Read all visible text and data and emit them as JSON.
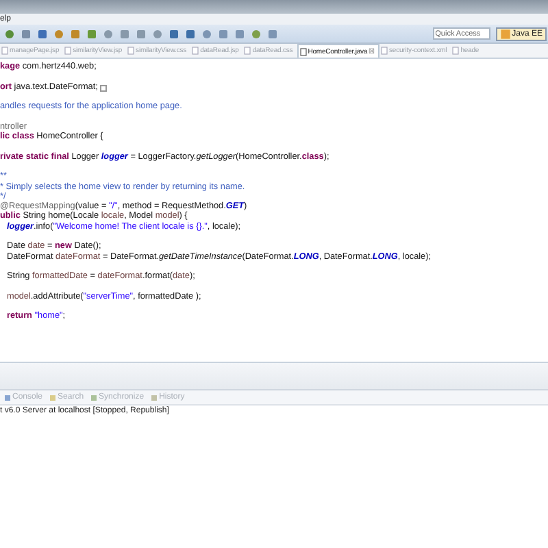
{
  "menu": {
    "items": [
      "elp"
    ]
  },
  "toolbar": {
    "quick_access": {
      "placeholder": "Quick Access"
    },
    "perspective": {
      "label": "Java EE",
      "selected": true
    }
  },
  "tabs": [
    {
      "label": "managePage.jsp",
      "selected": false
    },
    {
      "label": "similarityView.jsp",
      "selected": false
    },
    {
      "label": "similarityView.css",
      "selected": false
    },
    {
      "label": "dataRead.jsp",
      "selected": false
    },
    {
      "label": "dataRead.css",
      "selected": false
    },
    {
      "label": "HomeController.java",
      "selected": true,
      "close": "☒"
    },
    {
      "label": "security-context.xml",
      "selected": false
    },
    {
      "label": "heade",
      "selected": false
    }
  ],
  "code": [
    {
      "kind": "top",
      "blank_before": false,
      "tokens": [
        {
          "kind": "kw",
          "t": "kage"
        },
        {
          "kind": "plain",
          "t": " com.hertz440.web;"
        }
      ]
    },
    {
      "kind": "top",
      "blank_before": true,
      "folded": true,
      "tokens": [
        {
          "kind": "kw",
          "t": "ort"
        },
        {
          "kind": "plain",
          "t": " java.text.DateFormat;"
        }
      ]
    },
    {
      "kind": "top",
      "blank_before": true,
      "tokens": [
        {
          "kind": "comment",
          "t": "andles requests for the application home page."
        }
      ]
    },
    {
      "kind": "top",
      "blank_before": true,
      "tokens": [
        {
          "kind": "annotation",
          "t": "ntroller"
        }
      ]
    },
    {
      "kind": "top",
      "blank_before": false,
      "tokens": [
        {
          "kind": "kw",
          "t": "lic class"
        },
        {
          "kind": "plain",
          "t": " HomeController {"
        }
      ]
    },
    {
      "kind": "top",
      "blank_before": true,
      "tokens": [
        {
          "kind": "kw",
          "t": "rivate static final"
        },
        {
          "kind": "plain",
          "t": " Logger "
        },
        {
          "kind": "static",
          "t": "logger"
        },
        {
          "kind": "plain",
          "t": " = LoggerFactory."
        },
        {
          "kind": "smethod",
          "t": "getLogger"
        },
        {
          "kind": "plain",
          "t": "(HomeController."
        },
        {
          "kind": "kw",
          "t": "class"
        },
        {
          "kind": "plain",
          "t": ");"
        }
      ]
    },
    {
      "kind": "top",
      "blank_before": true,
      "tokens": [
        {
          "kind": "comment",
          "t": "**"
        }
      ]
    },
    {
      "kind": "top",
      "blank_before": false,
      "tokens": [
        {
          "kind": "comment",
          "t": "* Simply selects the home view to render by returning its name."
        }
      ]
    },
    {
      "kind": "top",
      "blank_before": false,
      "tokens": [
        {
          "kind": "comment",
          "t": "*/"
        }
      ]
    },
    {
      "kind": "top",
      "blank_before": false,
      "tokens": [
        {
          "kind": "annotation",
          "t": "@RequestMapping"
        },
        {
          "kind": "plain",
          "t": "(value = "
        },
        {
          "kind": "string",
          "t": "\"/\""
        },
        {
          "kind": "plain",
          "t": ", method = RequestMethod."
        },
        {
          "kind": "constant",
          "t": "GET"
        },
        {
          "kind": "plain",
          "t": ")"
        }
      ]
    },
    {
      "kind": "top",
      "blank_before": false,
      "tokens": [
        {
          "kind": "kw",
          "t": "ublic"
        },
        {
          "kind": "plain",
          "t": " String home(Locale "
        },
        {
          "kind": "local",
          "t": "locale"
        },
        {
          "kind": "plain",
          "t": ", Model "
        },
        {
          "kind": "local",
          "t": "model"
        },
        {
          "kind": "plain",
          "t": ") {"
        }
      ]
    },
    {
      "kind": "body",
      "blank_before": false,
      "tokens": [
        {
          "kind": "static",
          "t": "logger"
        },
        {
          "kind": "plain",
          "t": ".info("
        },
        {
          "kind": "string",
          "t": "\"Welcome home! The client locale is {}.\""
        },
        {
          "kind": "plain",
          "t": ", locale);"
        }
      ]
    },
    {
      "kind": "body",
      "blank_before": true,
      "tokens": [
        {
          "kind": "plain",
          "t": "Date "
        },
        {
          "kind": "local",
          "t": "date"
        },
        {
          "kind": "plain",
          "t": " = "
        },
        {
          "kind": "kw",
          "t": "new"
        },
        {
          "kind": "plain",
          "t": " Date();"
        }
      ]
    },
    {
      "kind": "body",
      "blank_before": false,
      "tokens": [
        {
          "kind": "plain",
          "t": "DateFormat "
        },
        {
          "kind": "local",
          "t": "dateFormat"
        },
        {
          "kind": "plain",
          "t": " = DateFormat."
        },
        {
          "kind": "smethod",
          "t": "getDateTimeInstance"
        },
        {
          "kind": "plain",
          "t": "(DateFormat."
        },
        {
          "kind": "constant",
          "t": "LONG"
        },
        {
          "kind": "plain",
          "t": ", DateFormat."
        },
        {
          "kind": "constant",
          "t": "LONG"
        },
        {
          "kind": "plain",
          "t": ", locale);"
        }
      ]
    },
    {
      "kind": "body",
      "blank_before": true,
      "tokens": [
        {
          "kind": "plain",
          "t": "String "
        },
        {
          "kind": "local",
          "t": "formattedDate"
        },
        {
          "kind": "plain",
          "t": " = "
        },
        {
          "kind": "local",
          "t": "dateFormat"
        },
        {
          "kind": "plain",
          "t": ".format("
        },
        {
          "kind": "local",
          "t": "date"
        },
        {
          "kind": "plain",
          "t": ");"
        }
      ]
    },
    {
      "kind": "body",
      "blank_before": true,
      "tokens": [
        {
          "kind": "local",
          "t": "model"
        },
        {
          "kind": "plain",
          "t": ".addAttribute("
        },
        {
          "kind": "string",
          "t": "\"serverTime\""
        },
        {
          "kind": "plain",
          "t": ", formattedDate );"
        }
      ]
    },
    {
      "kind": "body",
      "blank_before": true,
      "tokens": [
        {
          "kind": "kw",
          "t": "return"
        },
        {
          "kind": "string",
          "t": " \"home\""
        },
        {
          "kind": "plain",
          "t": ";"
        }
      ]
    }
  ],
  "bottom_panel": {
    "tabs": [
      {
        "label": "Console",
        "selected": false
      },
      {
        "label": "Search",
        "selected": false
      },
      {
        "label": "Synchronize",
        "selected": false
      },
      {
        "label": "History",
        "selected": false
      }
    ],
    "server_line": "t v6.0 Server at localhost  [Stopped, Republish]"
  }
}
